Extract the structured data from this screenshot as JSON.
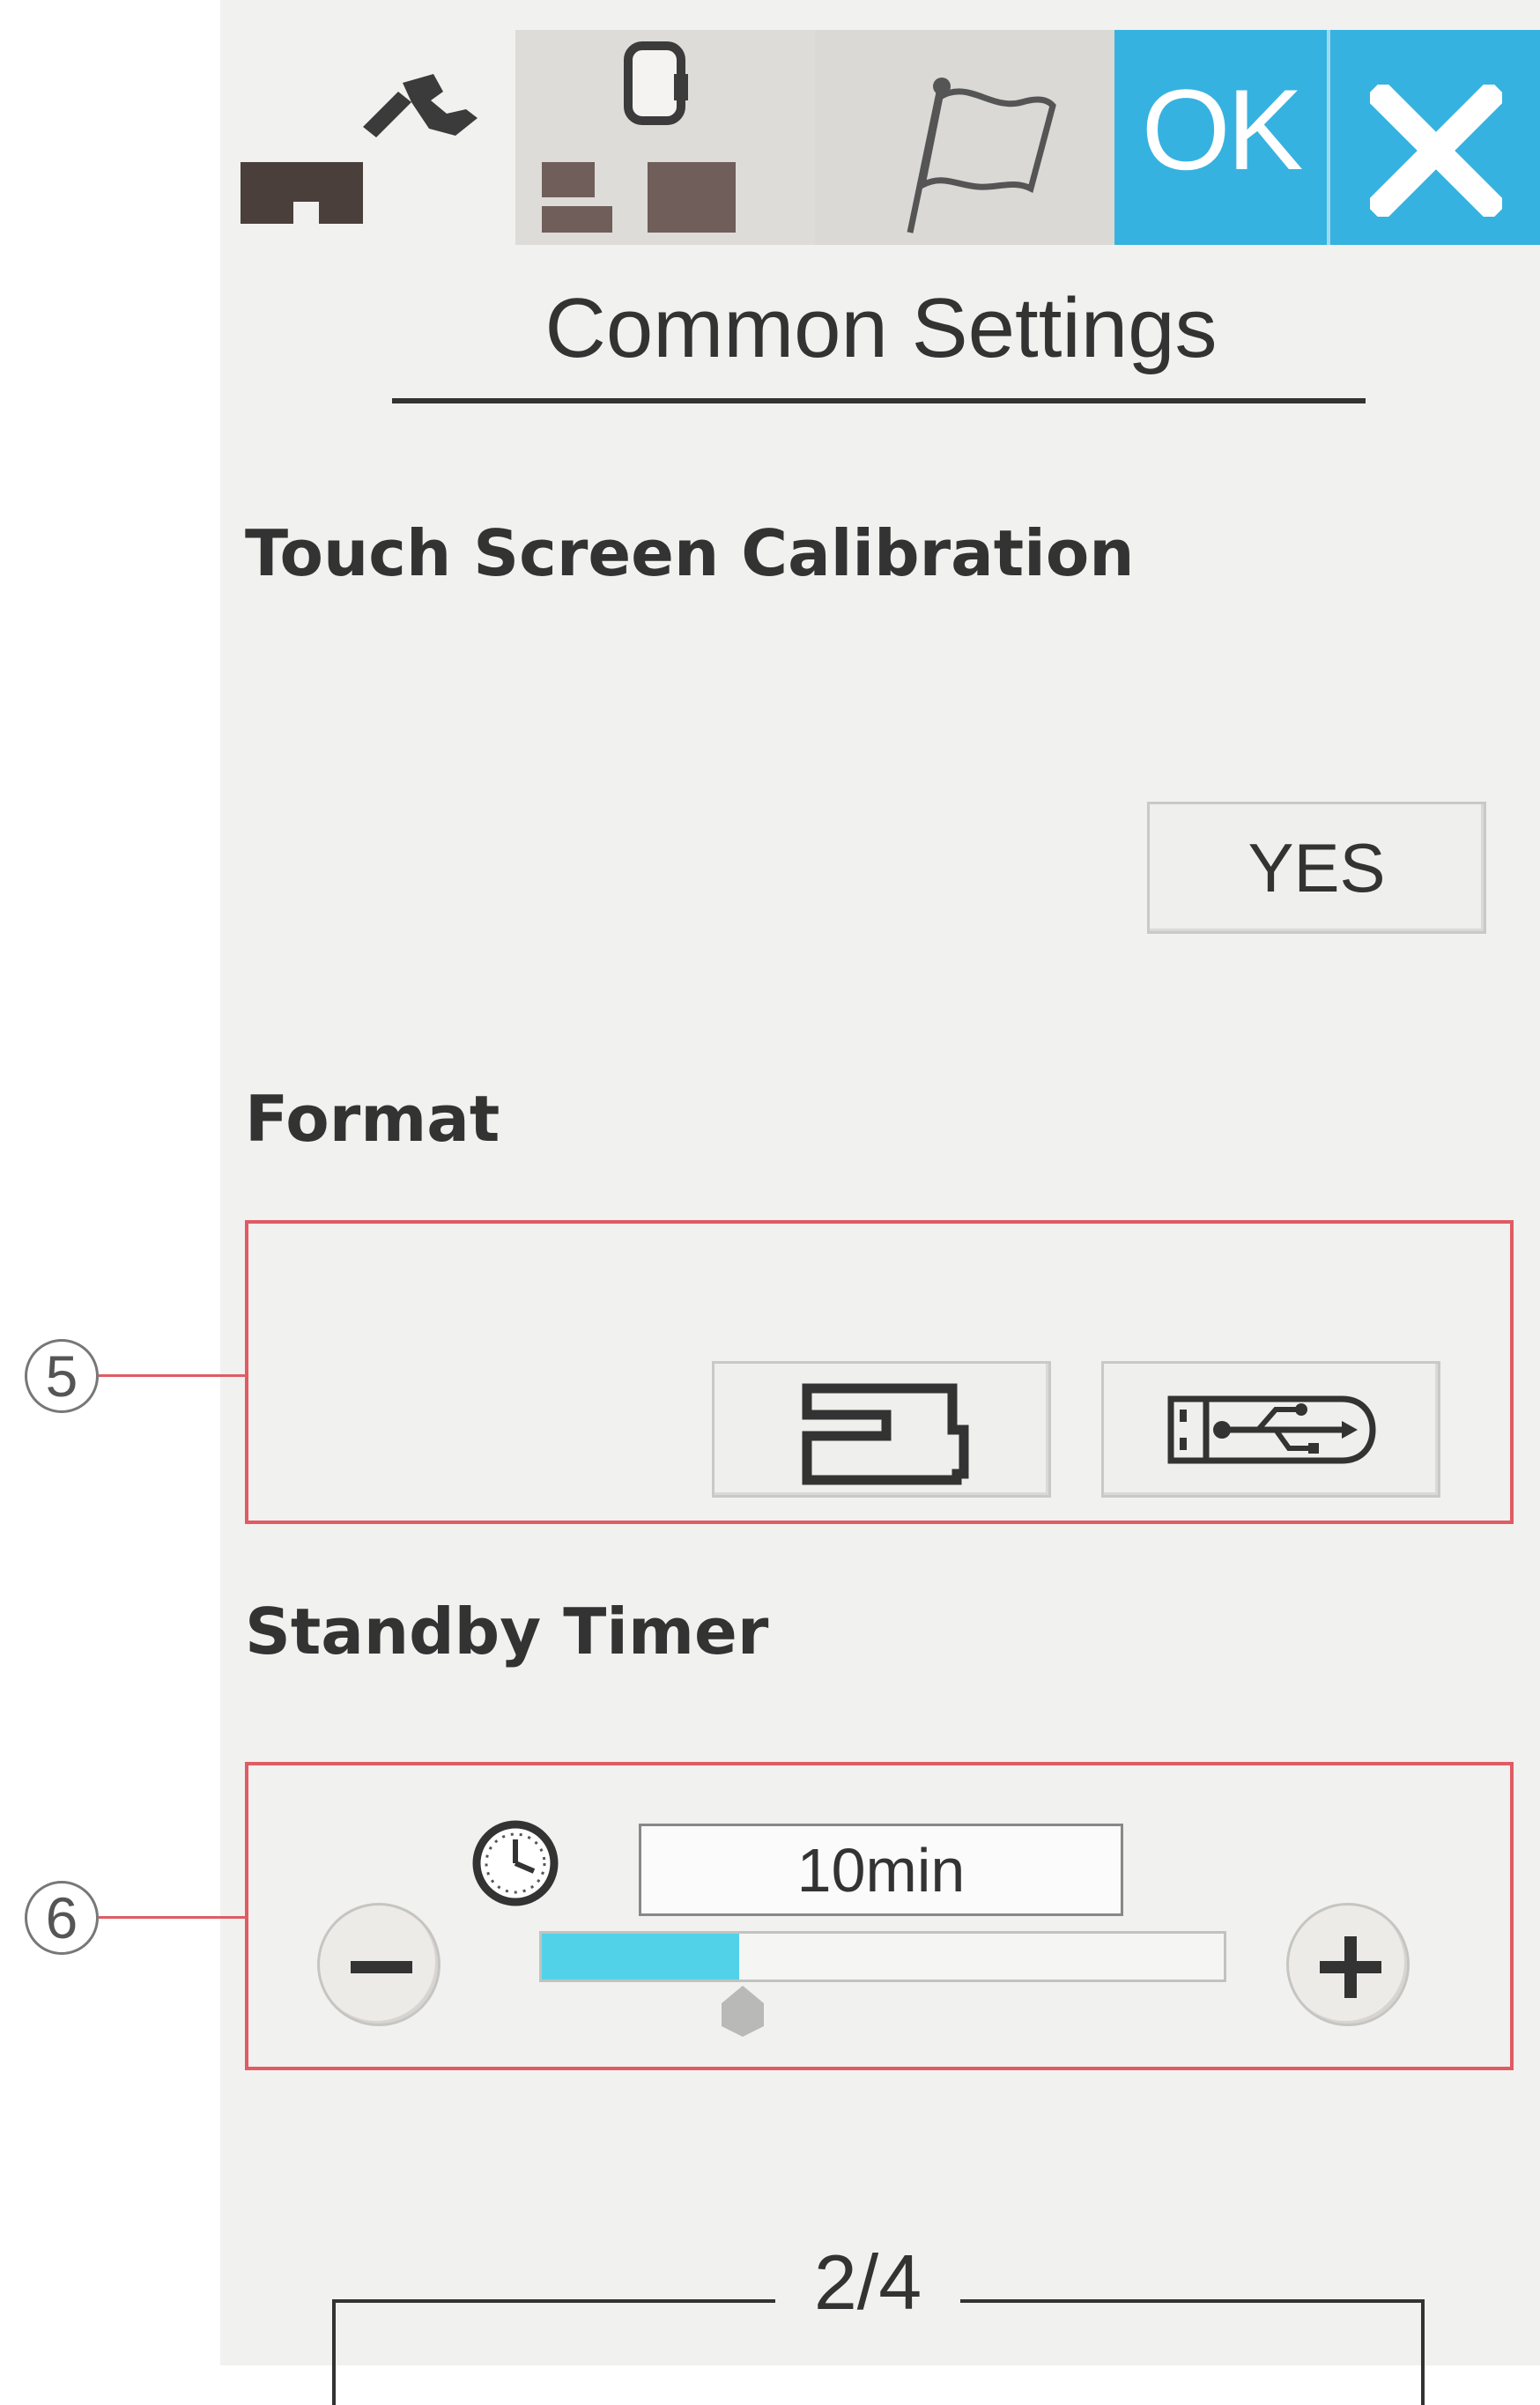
{
  "toolbar": {
    "tabs": [
      {
        "name": "common-settings",
        "icon": "machine-wrench-icon"
      },
      {
        "name": "embroidery-settings",
        "icon": "machine-hoop-icon"
      },
      {
        "name": "language-settings",
        "icon": "flag-icon"
      }
    ],
    "ok_label": "OK",
    "close_icon": "close-icon",
    "accent_color": "#36b2e0"
  },
  "page": {
    "title": "Common Settings"
  },
  "touch_calibration": {
    "label": "Touch Screen Calibration",
    "button_label": "YES"
  },
  "format": {
    "label": "Format",
    "callout": "5",
    "options": [
      {
        "name": "machine-memory",
        "icon": "sewing-machine-icon"
      },
      {
        "name": "usb-memory",
        "icon": "usb-stick-icon"
      }
    ]
  },
  "standby_timer": {
    "label": "Standby Timer",
    "callout": "6",
    "value": "10min",
    "level_fraction": 0.29,
    "decrease_icon": "minus-icon",
    "increase_icon": "plus-icon",
    "clock_icon": "clock-icon",
    "fill_color": "#52d2e8"
  },
  "pager": {
    "label": "2/4"
  },
  "annotation_color": "#e05b63"
}
